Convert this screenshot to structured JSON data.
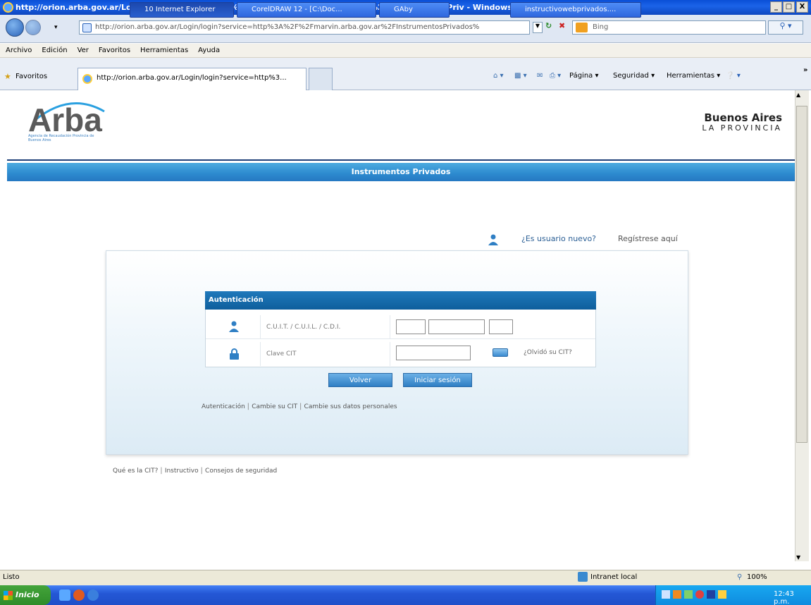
{
  "window": {
    "title": "http://orion.arba.gov.ar/Login/login?service=http%3A%2F%2Fmarvin.arba.gov.ar%2FInstrumentosPriv - Windows Internet Explorer",
    "minimize": "_",
    "maximize": "□",
    "close": "X"
  },
  "nav": {
    "address": "http://orion.arba.gov.ar/Login/login?service=http%3A%2F%2Fmarvin.arba.gov.ar%2FInstrumentosPrivados%",
    "search_placeholder": "Bing"
  },
  "menu": [
    "Archivo",
    "Edición",
    "Ver",
    "Favoritos",
    "Herramientas",
    "Ayuda"
  ],
  "favorites": {
    "label": "Favoritos",
    "tab_title": "http://orion.arba.gov.ar/Login/login?service=http%3...",
    "commands": [
      "Página ▾",
      "Seguridad ▾",
      "Herramientas ▾"
    ]
  },
  "header": {
    "logo_text": "Arba",
    "logo_subtext": "Agencia de Recaudación Provincia de Buenos Aires",
    "province_line1": "Buenos Aires",
    "province_line2": "LA PROVINCIA",
    "section_title": "Instrumentos Privados"
  },
  "register": {
    "question": "¿Es usuario nuevo?",
    "link": "Regístrese aquí"
  },
  "login": {
    "header": "Autenticación",
    "cuit_label": "C.U.I.T. / C.U.I.L. / C.D.I.",
    "cit_label": "Clave CIT",
    "forgot_link": "¿Olvidó su CIT?",
    "back_button": "Volver",
    "login_button": "Iniciar sesión",
    "bottom_links": [
      "Autenticación",
      "Cambie su CIT",
      "Cambie sus datos personales"
    ]
  },
  "footer_links": [
    "Qué es la CIT?",
    "Instructivo",
    "Consejos de seguridad"
  ],
  "status": {
    "text": "Listo",
    "zone": "Intranet local",
    "zoom": "100%"
  },
  "taskbar": {
    "start": "Inicio",
    "items": [
      "10 Internet Explorer",
      "CorelDRAW 12 - [C:\\Doc...",
      "GAby",
      "instructivowebprivados...."
    ],
    "clock": "12:43 p.m."
  }
}
